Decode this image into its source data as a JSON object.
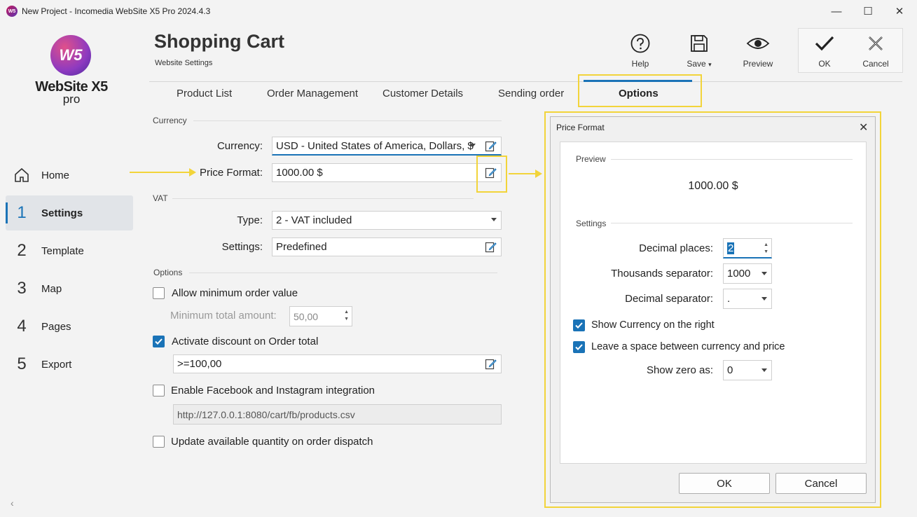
{
  "window": {
    "title": "New Project - Incomedia WebSite X5 Pro 2024.4.3",
    "app_icon_text": "W5",
    "minimize": "—",
    "maximize": "☐",
    "close": "✕"
  },
  "logo": {
    "mark": "W5",
    "name": "WebSite X5",
    "edition": "pro"
  },
  "sidebar": {
    "items": [
      {
        "num": "",
        "label": "Home"
      },
      {
        "num": "1",
        "label": "Settings"
      },
      {
        "num": "2",
        "label": "Template"
      },
      {
        "num": "3",
        "label": "Map"
      },
      {
        "num": "4",
        "label": "Pages"
      },
      {
        "num": "5",
        "label": "Export"
      }
    ],
    "collapse": "‹"
  },
  "header": {
    "title": "Shopping Cart",
    "subtitle": "Website Settings",
    "help": "Help",
    "save": "Save",
    "save_caret": "▾",
    "preview": "Preview",
    "ok": "OK",
    "cancel": "Cancel"
  },
  "tabs": [
    "Product List",
    "Order Management",
    "Customer Details",
    "Sending order",
    "Options"
  ],
  "currency_section": {
    "label": "Currency",
    "currency_label": "Currency:",
    "currency_value": "USD - United States of America, Dollars, $",
    "price_format_label": "Price Format:",
    "price_format_value": "1000.00 $"
  },
  "vat_section": {
    "label": "VAT",
    "type_label": "Type:",
    "type_value": "2 - VAT included",
    "settings_label": "Settings:",
    "settings_value": "Predefined"
  },
  "options_section": {
    "label": "Options",
    "allow_min_order": "Allow minimum order value",
    "min_total_label": "Minimum total amount:",
    "min_total_value": "50,00",
    "activate_discount": "Activate discount on Order total",
    "discount_value": ">=100,00",
    "facebook_integration": "Enable Facebook and Instagram integration",
    "facebook_url": "http://127.0.0.1:8080/cart/fb/products.csv",
    "update_quantity": "Update available quantity on order dispatch"
  },
  "dialog": {
    "title": "Price Format",
    "close": "✕",
    "preview_label": "Preview",
    "preview_value": "1000.00 $",
    "settings_label": "Settings",
    "decimal_places_label": "Decimal places:",
    "decimal_places_value": "2",
    "thousands_sep_label": "Thousands separator:",
    "thousands_sep_value": "1000",
    "decimal_sep_label": "Decimal separator:",
    "decimal_sep_value": ".",
    "show_currency_right": "Show Currency on the right",
    "space_between": "Leave a space between currency and price",
    "show_zero_label": "Show zero as:",
    "show_zero_value": "0",
    "ok": "OK",
    "cancel": "Cancel"
  },
  "colors": {
    "accent": "#1a73b7",
    "highlight": "#f2d43a"
  }
}
